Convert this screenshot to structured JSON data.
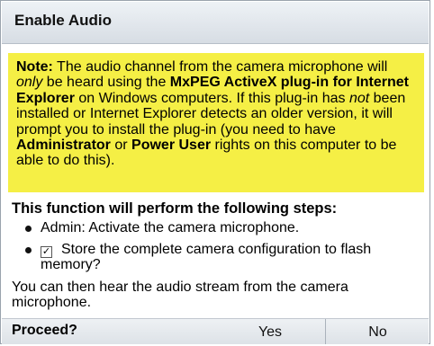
{
  "dialog": {
    "title": "Enable Audio",
    "note": {
      "label": "Note:",
      "t1": " The audio channel from the camera microphone will ",
      "only": "only",
      "t2": " be heard using the ",
      "plugin": "MxPEG ActiveX plug-in for Internet Explorer",
      "t3": " on Windows computers. If this plug-in has ",
      "not": "not",
      "t4": " been installed or Internet Explorer detects an older version, it will prompt you to install the plug-in (you need to have ",
      "admin": "Administrator",
      "t5": " or ",
      "power": "Power User",
      "t6": " rights on this computer to be able to do this)."
    },
    "steps_heading": "This function will perform the following steps:",
    "steps": [
      "Admin: Activate the camera microphone.",
      "Store the complete camera configuration to flash memory?"
    ],
    "store_checked": true,
    "checkbox_mark": "✓",
    "then_text": "You can then hear the audio stream from the camera microphone.",
    "footer": {
      "prompt": "Proceed?",
      "yes": "Yes",
      "no": "No"
    }
  }
}
